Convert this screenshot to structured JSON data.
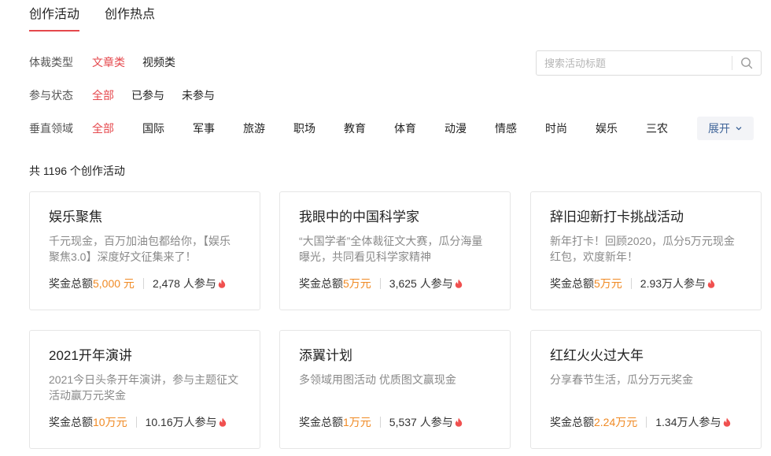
{
  "tabs": [
    {
      "label": "创作活动",
      "active": true
    },
    {
      "label": "创作热点",
      "active": false
    }
  ],
  "filters": {
    "genre": {
      "label": "体裁类型",
      "options": [
        "文章类",
        "视频类"
      ],
      "selected": "文章类"
    },
    "status": {
      "label": "参与状态",
      "options": [
        "全部",
        "已参与",
        "未参与"
      ],
      "selected": "全部"
    },
    "vertical": {
      "label": "垂直领域",
      "options": [
        "全部",
        "国际",
        "军事",
        "旅游",
        "职场",
        "教育",
        "体育",
        "动漫",
        "情感",
        "时尚",
        "娱乐",
        "三农"
      ],
      "selected": "全部"
    }
  },
  "search": {
    "placeholder": "搜索活动标题",
    "value": ""
  },
  "expand_label": "展开",
  "summary": "共 1196 个创作活动",
  "colors": {
    "accent": "#e5484d",
    "prize": "#f08a24",
    "link": "#406599"
  },
  "cards": [
    {
      "title": "娱乐聚焦",
      "desc": "千元现金，百万加油包都给你，【娱乐聚焦3.0】深度好文征集来了！",
      "prize_label": "奖金总额",
      "prize": "5,000 元",
      "participants": "2,478 人参与"
    },
    {
      "title": "我眼中的中国科学家",
      "desc": "“大国学者”全体裁征文大赛，瓜分海量曝光，共同看见科学家精神",
      "prize_label": "奖金总额",
      "prize": "5万元",
      "participants": "3,625 人参与"
    },
    {
      "title": "辞旧迎新打卡挑战活动",
      "desc": "新年打卡！回顾2020，瓜分5万元现金红包，欢度新年！",
      "prize_label": "奖金总额",
      "prize": "5万元",
      "participants": "2.93万人参与"
    },
    {
      "title": "2021开年演讲",
      "desc": "2021今日头条开年演讲，参与主题征文活动赢万元奖金",
      "prize_label": "奖金总额",
      "prize": "10万元",
      "participants": "10.16万人参与"
    },
    {
      "title": "添翼计划",
      "desc": "多领域用图活动 优质图文赢现金",
      "prize_label": "奖金总额",
      "prize": "1万元",
      "participants": "5,537 人参与"
    },
    {
      "title": "红红火火过大年",
      "desc": "分享春节生活，瓜分万元奖金",
      "prize_label": "奖金总额",
      "prize": "2.24万元",
      "participants": "1.34万人参与"
    }
  ]
}
